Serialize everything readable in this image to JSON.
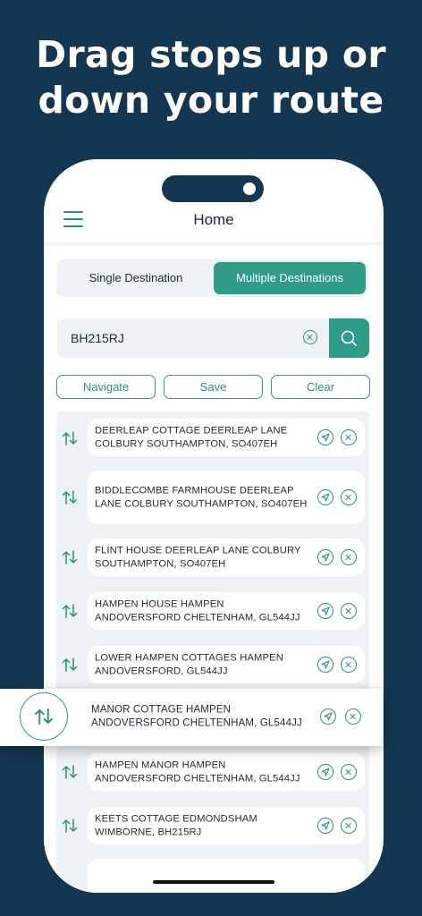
{
  "headline": {
    "line1": "Drag stops up or",
    "line2": "down your route"
  },
  "header": {
    "title": "Home",
    "menu_icon": "hamburger-menu-icon"
  },
  "segmented": {
    "single_label": "Single Destination",
    "multiple_label": "Multiple Destinations",
    "selected": "Multiple Destinations"
  },
  "search": {
    "value": "BH215RJ"
  },
  "actions": {
    "navigate_label": "Navigate",
    "save_label": "Save",
    "clear_label": "Clear"
  },
  "stops": [
    {
      "address": "DEERLEAP COTTAGE DEERLEAP LANE COLBURY SOUTHAMPTON, SO407EH"
    },
    {
      "address": "BIDDLECOMBE FARMHOUSE DEERLEAP LANE COLBURY SOUTHAMPTON, SO407EH"
    },
    {
      "address": "FLINT HOUSE DEERLEAP LANE COLBURY SOUTHAMPTON, SO407EH"
    },
    {
      "address": "HAMPEN HOUSE HAMPEN ANDOVERSFORD CHELTENHAM, GL544JJ"
    },
    {
      "address": "LOWER HAMPEN COTTAGES HAMPEN ANDOVERSFORD, GL544JJ"
    },
    {
      "address": "HAMPEN MANOR HAMPEN ANDOVERSFORD CHELTENHAM, GL544JJ"
    },
    {
      "address": "KEETS COTTAGE EDMONDSHAM WIMBORNE, BH215RJ"
    }
  ],
  "dragging_stop": {
    "address": "MANOR COTTAGE HAMPEN ANDOVERSFORD CHELTENHAM, GL544JJ"
  },
  "colors": {
    "background": "#143650",
    "accent": "#2e9c87",
    "list_bg": "#edf2f4"
  }
}
